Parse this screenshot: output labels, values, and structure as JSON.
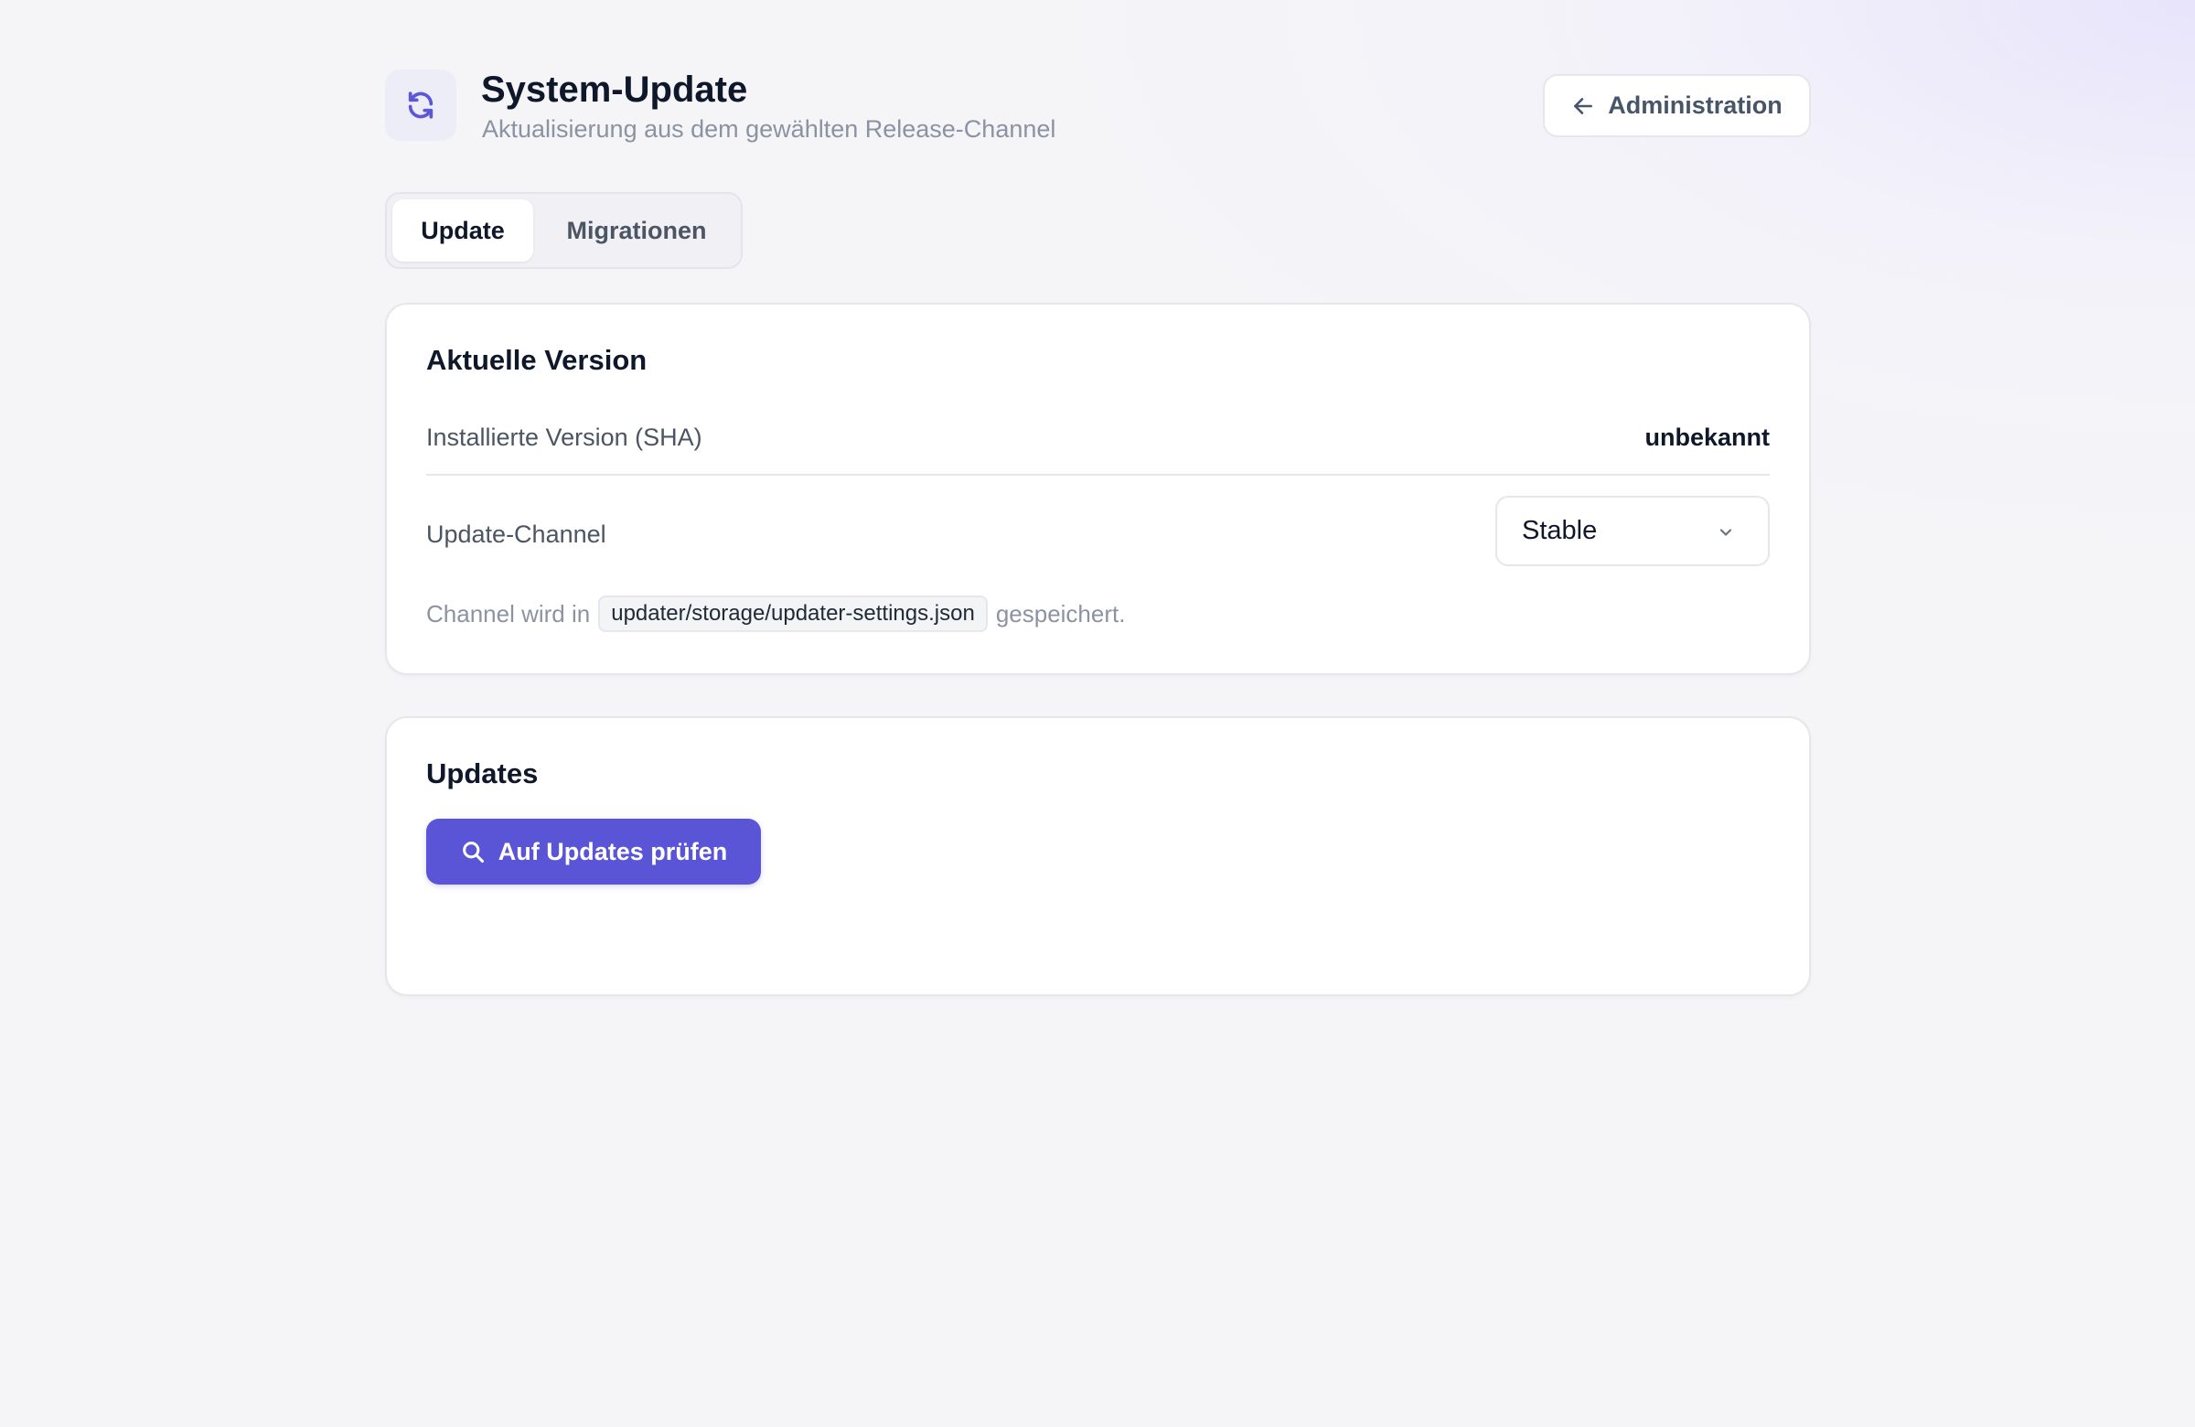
{
  "header": {
    "title": "System-Update",
    "subtitle": "Aktualisierung aus dem gewählten Release-Channel",
    "icon": "refresh-icon",
    "back_button": {
      "icon": "arrow-left-icon",
      "label": "Administration"
    }
  },
  "tabs": [
    {
      "label": "Update",
      "active": true
    },
    {
      "label": "Migrationen",
      "active": false
    }
  ],
  "version_card": {
    "title": "Aktuelle Version",
    "installed_label": "Installierte Version (SHA)",
    "installed_value": "unbekannt",
    "channel_label": "Update-Channel",
    "channel_selected": "Stable",
    "hint_prefix": "Channel wird in",
    "hint_path": "updater/storage/updater-settings.json",
    "hint_suffix": "gespeichert."
  },
  "updates_card": {
    "title": "Updates",
    "check_button": {
      "icon": "search-icon",
      "label": "Auf Updates prüfen"
    }
  },
  "colors": {
    "accent": "#5a55d7",
    "icon_tint": "#5b57d9",
    "background": "#f5f5f8",
    "muted_text": "#8b93a3"
  }
}
